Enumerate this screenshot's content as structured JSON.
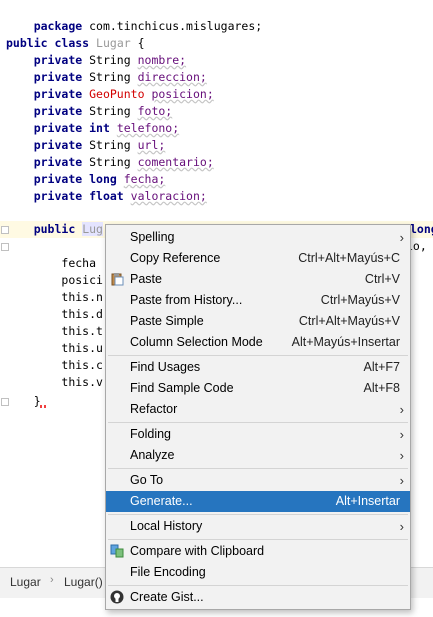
{
  "code": {
    "package_line": "package com.tinchicus.mislugares;",
    "class_line": [
      "public",
      "class",
      "Lugar",
      "{"
    ],
    "fields": [
      {
        "mods": "private",
        "type": "String",
        "name": "nombre;"
      },
      {
        "mods": "private",
        "type": "String",
        "name": "direccion;"
      },
      {
        "mods": "private",
        "type": "GeoPunto",
        "name": "posicion;"
      },
      {
        "mods": "private",
        "type": "String",
        "name": "foto;"
      },
      {
        "mods": "private",
        "type": "int",
        "name": "telefono;"
      },
      {
        "mods": "private",
        "type": "String",
        "name": "url;"
      },
      {
        "mods": "private",
        "type": "String",
        "name": "comentario;"
      },
      {
        "mods": "private",
        "type": "long",
        "name": "fecha;"
      },
      {
        "mods": "private",
        "type": "float",
        "name": "valoracion;"
      }
    ],
    "ctor_public": "public",
    "ctor_name": "Lug",
    "ctor_right_1": "long",
    "ctor_right_2": "io,",
    "body_lines": [
      "fecha ",
      "posici",
      "this.n",
      "this.d",
      "this.t",
      "this.u",
      "this.c",
      "this.v"
    ],
    "closing": "}"
  },
  "breadcrumb": {
    "items": [
      "Lugar",
      "Lugar()"
    ],
    "separator": "›"
  },
  "menu": {
    "items": [
      {
        "label": "Spelling",
        "mnemonic": "",
        "shortcut": "",
        "submenu": true
      },
      {
        "label": "Copy Reference",
        "shortcut": "Ctrl+Alt+Mayús+C"
      },
      {
        "label": "Paste",
        "shortcut": "Ctrl+V"
      },
      {
        "label": "Paste from History...",
        "shortcut": "Ctrl+Mayús+V"
      },
      {
        "label": "Paste Simple",
        "shortcut": "Ctrl+Alt+Mayús+V"
      },
      {
        "label": "Column Selection Mode",
        "shortcut": "Alt+Mayús+Insertar"
      },
      {
        "label": "Find Usages",
        "shortcut": "Alt+F7"
      },
      {
        "label": "Find Sample Code",
        "shortcut": "Alt+F8"
      },
      {
        "label": "Refactor",
        "submenu": true
      },
      {
        "label": "Folding",
        "submenu": true
      },
      {
        "label": "Analyze",
        "submenu": true
      },
      {
        "label": "Go To",
        "submenu": true
      },
      {
        "label": "Generate...",
        "shortcut": "Alt+Insertar",
        "selected": true
      },
      {
        "label": "Local History",
        "submenu": true
      },
      {
        "label": "Compare with Clipboard"
      },
      {
        "label": "File Encoding"
      },
      {
        "label": "Create Gist..."
      }
    ]
  },
  "colors": {
    "keyword": "#000080",
    "error_type": "#d20000",
    "selection": "#2675bf",
    "menu_bg": "#f2f2f2"
  },
  "icons": {
    "paste": "clipboard-icon",
    "compare": "compare-clipboard-icon",
    "gist": "github-icon"
  }
}
